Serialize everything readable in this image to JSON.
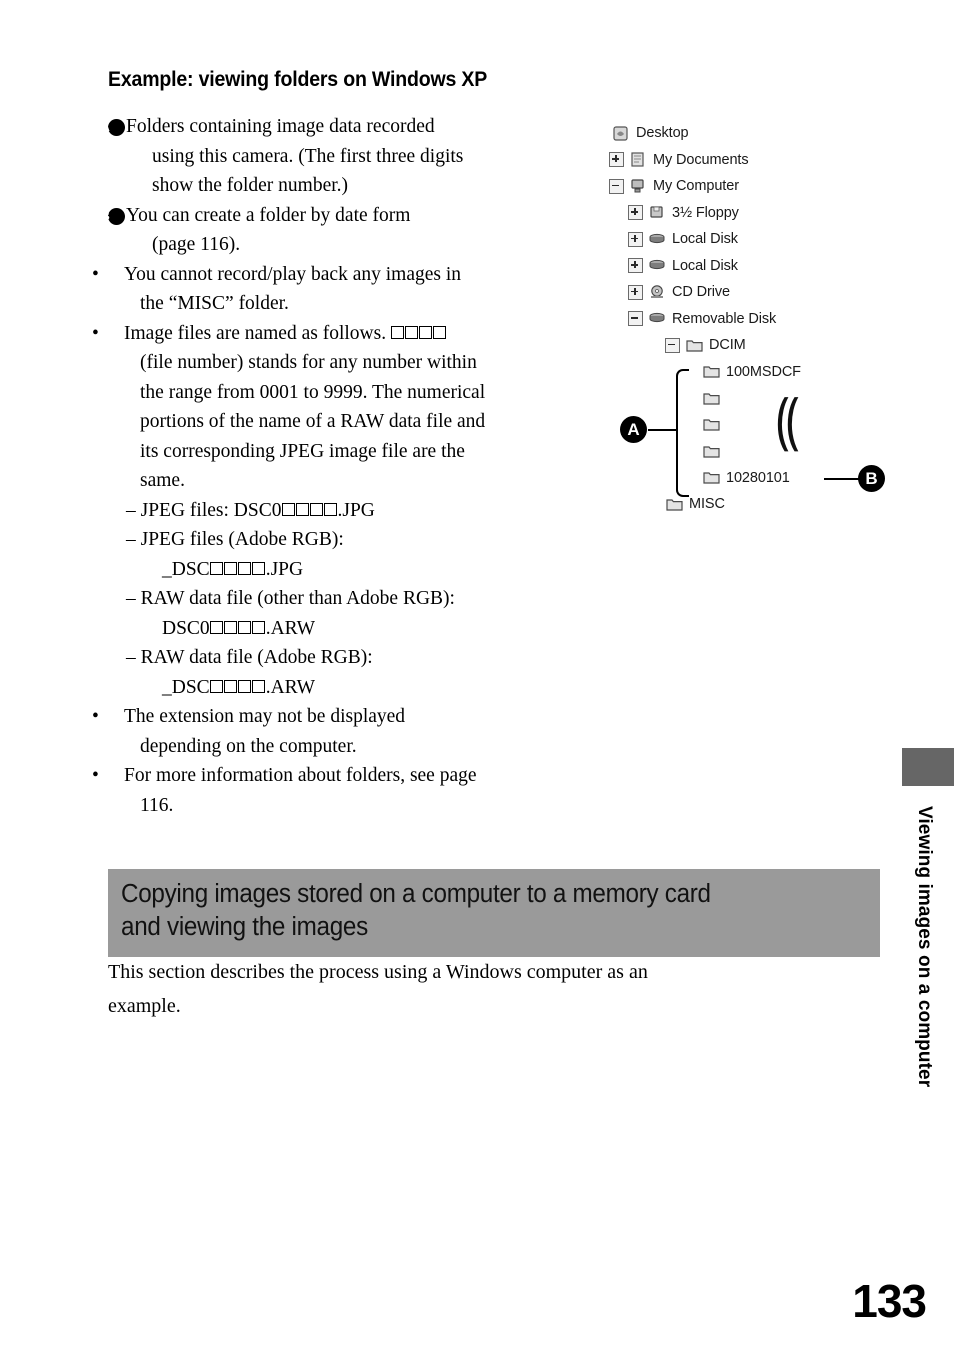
{
  "page": {
    "number": "133",
    "side_tab_label": "Viewing images on a computer"
  },
  "example_section": {
    "title": "Example: viewing folders on Windows XP",
    "items": [
      {
        "marker": "A",
        "lines": [
          "Folders containing image data recorded",
          "using this camera. (The first three digits",
          "show the folder number.)"
        ]
      },
      {
        "marker": "B",
        "lines": [
          "You can create a folder by date form",
          "(page 116)."
        ]
      }
    ],
    "bullets": [
      {
        "lines": [
          "You cannot record/play back any images in",
          "the “MISC” folder."
        ]
      },
      {
        "lines": [
          "Image files are named as follows.",
          "(file number) stands for any number within",
          "the range from 0001 to 9999. The numerical",
          "portions of the name of a RAW data file and",
          "its corresponding JPEG image file are the",
          "same."
        ]
      },
      {
        "lines": [
          "The extension may not be displayed",
          "depending on the computer."
        ]
      },
      {
        "lines": [
          "For more information about folders, see page",
          "116."
        ]
      }
    ],
    "file_name_examples": [
      {
        "label": "– JPEG files: DSC0",
        "suffix": ".JPG",
        "boxes": 4
      },
      {
        "label": "– JPEG files (Adobe RGB):",
        "second_line_prefix": "_DSC",
        "suffix": ".JPG",
        "boxes": 4
      },
      {
        "label": "– RAW data file (other than Adobe RGB):",
        "second_line_prefix": "DSC0",
        "suffix": ".ARW",
        "boxes": 4
      },
      {
        "label": "– RAW data file (Adobe RGB):",
        "second_line_prefix": "_DSC",
        "suffix": ".ARW",
        "boxes": 4
      }
    ]
  },
  "tree": {
    "rows": [
      {
        "label": "Desktop",
        "indent": 0,
        "expander": "none",
        "icon": "desktop-icon"
      },
      {
        "label": "My Documents",
        "indent": 1,
        "expander": "plus",
        "icon": "my-documents-icon"
      },
      {
        "label": "My Computer",
        "indent": 1,
        "expander": "minus",
        "icon": "my-computer-icon"
      },
      {
        "label": "3½ Floppy",
        "indent": 2,
        "expander": "plus",
        "icon": "floppy-drive-icon"
      },
      {
        "label": "Local Disk",
        "indent": 2,
        "expander": "plus",
        "icon": "hard-disk-icon"
      },
      {
        "label": "Local Disk",
        "indent": 2,
        "expander": "plus",
        "icon": "hard-disk-icon"
      },
      {
        "label": "CD Drive",
        "indent": 2,
        "expander": "plus",
        "icon": "cd-drive-icon"
      },
      {
        "label": "Removable Disk",
        "indent": 2,
        "expander": "minus",
        "icon": "removable-disk-icon"
      },
      {
        "label": "DCIM",
        "indent": 3,
        "expander": "minus",
        "icon": "folder-icon"
      },
      {
        "label": "100MSDCF",
        "indent": 4,
        "expander": "none",
        "icon": "folder-icon"
      },
      {
        "label": "",
        "indent": 4,
        "expander": "none",
        "icon": "folder-icon"
      },
      {
        "label": "",
        "indent": 4,
        "expander": "none",
        "icon": "folder-icon"
      },
      {
        "label": "",
        "indent": 4,
        "expander": "none",
        "icon": "folder-icon"
      },
      {
        "label": "10280101",
        "indent": 4,
        "expander": "none",
        "icon": "folder-icon"
      },
      {
        "label": "MISC",
        "indent": 3,
        "expander": "none",
        "icon": "folder-icon"
      }
    ],
    "callouts": [
      {
        "id": "A",
        "target": "camera-image-folders"
      },
      {
        "id": "B",
        "target": "date-form-folder"
      }
    ],
    "continuation_symbol": "⸨"
  },
  "copy_section": {
    "heading_line_1": "Copying images stored on a computer to a memory card",
    "heading_line_2": "and viewing the images",
    "body_lines": [
      "This section describes the process using a Windows computer as an",
      "example."
    ]
  },
  "colors": {
    "band_gray": "#9a9a9a",
    "tab_gray": "#666666",
    "text": "#000000"
  }
}
